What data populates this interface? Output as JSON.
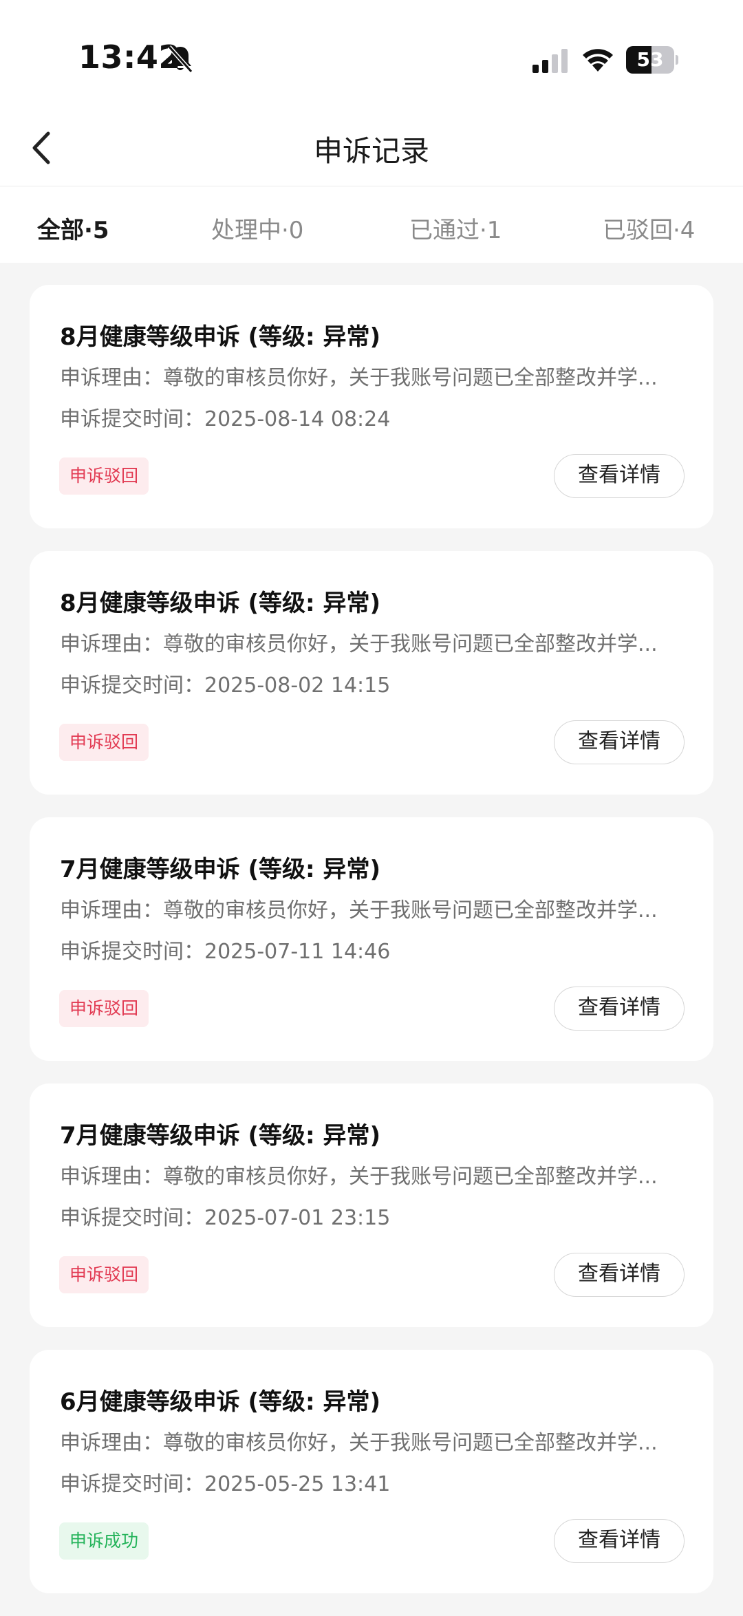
{
  "status_bar": {
    "time": "13:42",
    "battery": "53",
    "battery_level": 0.53
  },
  "header": {
    "title": "申诉记录"
  },
  "tabs": [
    {
      "label": "全部·5",
      "active": true
    },
    {
      "label": "处理中·0",
      "active": false
    },
    {
      "label": "已通过·1",
      "active": false
    },
    {
      "label": "已驳回·4",
      "active": false
    }
  ],
  "records": [
    {
      "title": "8月健康等级申诉 (等级: 异常)",
      "reason": "申诉理由：尊敬的审核员你好，关于我账号问题已全部整改并学...",
      "time": "申诉提交时间：2025-08-14 08:24",
      "status": "申诉驳回",
      "action": "查看详情"
    },
    {
      "title": "8月健康等级申诉 (等级: 异常)",
      "reason": "申诉理由：尊敬的审核员你好，关于我账号问题已全部整改并学...",
      "time": "申诉提交时间：2025-08-02 14:15",
      "status": "申诉驳回",
      "action": "查看详情"
    },
    {
      "title": "7月健康等级申诉 (等级: 异常)",
      "reason": "申诉理由：尊敬的审核员你好，关于我账号问题已全部整改并学...",
      "time": "申诉提交时间：2025-07-11 14:46",
      "status": "申诉驳回",
      "action": "查看详情"
    },
    {
      "title": "7月健康等级申诉 (等级: 异常)",
      "reason": "申诉理由：尊敬的审核员你好，关于我账号问题已全部整改并学...",
      "time": "申诉提交时间：2025-07-01 23:15",
      "status": "申诉驳回",
      "action": "查看详情"
    },
    {
      "title": "6月健康等级申诉 (等级: 异常)",
      "reason": "申诉理由：尊敬的审核员你好，关于我账号问题已全部整改并学...",
      "time": "申诉提交时间：2025-05-25 13:41",
      "status": "申诉成功",
      "action": "查看详情"
    }
  ],
  "colors": {
    "rejected": "#e23a52",
    "success": "#24b35a",
    "background": "#f5f5f5"
  }
}
